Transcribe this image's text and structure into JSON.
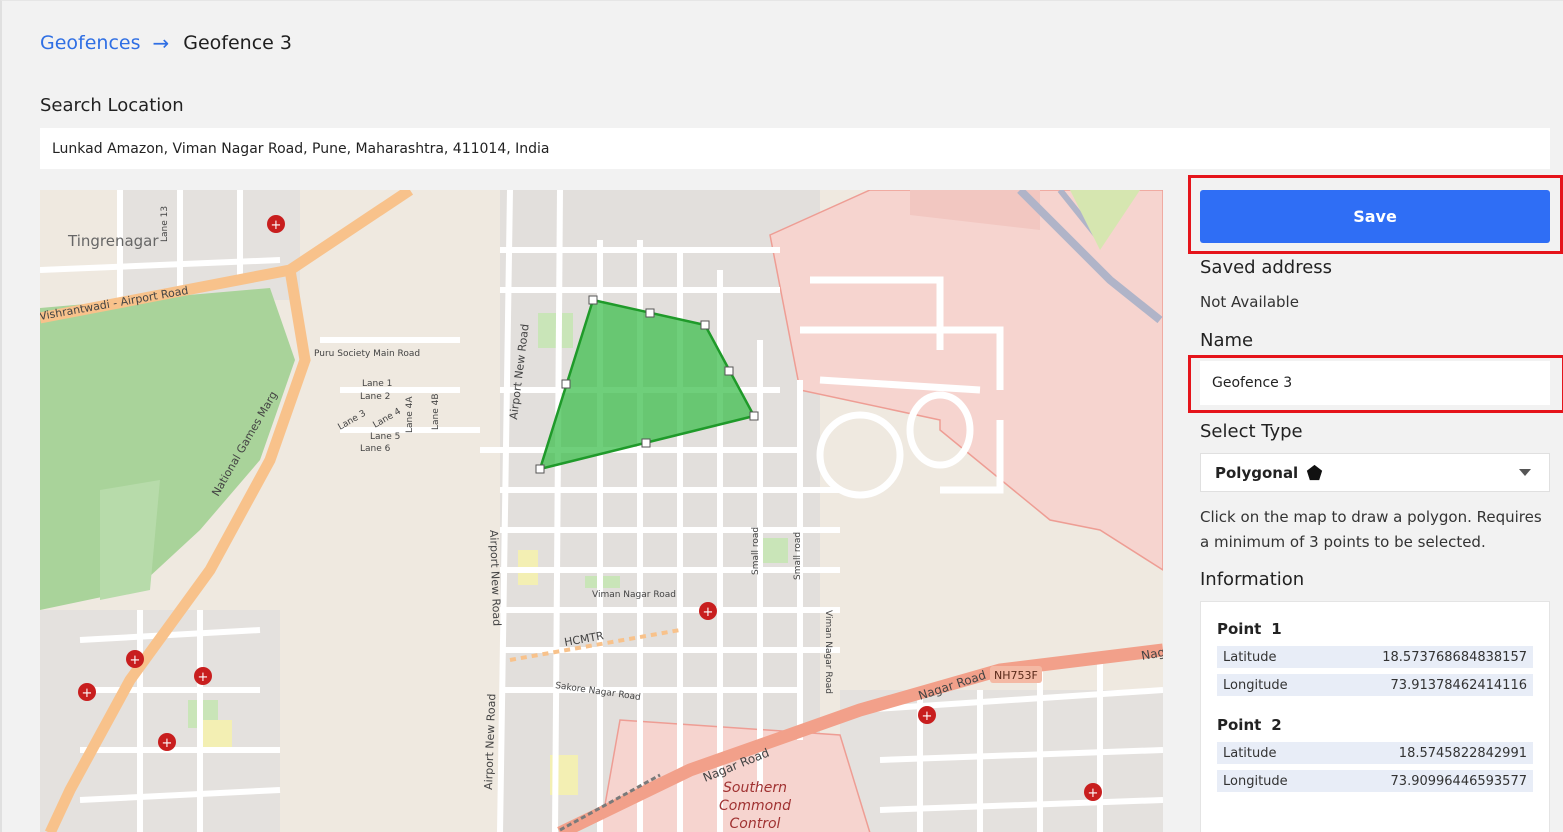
{
  "breadcrumb": {
    "parent": "Geofences",
    "arrow": "→",
    "current": "Geofence 3"
  },
  "search": {
    "label": "Search Location",
    "value": "Lunkad Amazon, Viman Nagar Road, Pune, Maharashtra, 411014, India"
  },
  "map": {
    "labels": {
      "tingrenagar": "Tingrenagar",
      "vishrantwadi": "Vishrantwadi - Airport Road",
      "national_games": "National Games Marg",
      "puru_society": "Puru Society Main Road",
      "lane1": "Lane 1",
      "lane2": "Lane 2",
      "lane3": "Lane 3",
      "lane4": "Lane 4",
      "lane4a": "Lane 4A",
      "lane4b": "Lane 4B",
      "lane5": "Lane 5",
      "lane6": "Lane 6",
      "lane13": "Lane 13",
      "airport_new_road_1": "Airport New Road",
      "airport_new_road_2": "Airport New Road",
      "airport_new_road_3": "Airport New Road",
      "viman_nagar_road_1": "Viman Nagar Road",
      "viman_nagar_road_2": "Viman Nagar Road",
      "hcmtr": "HCMTR",
      "sakore_nagar": "Sakore Nagar Road",
      "small_road_1": "Small road",
      "small_road_2": "Small road",
      "nagar_road_1": "Nagar Road",
      "nagar_road_2": "Nagar Road",
      "nagar_road_3": "Nag",
      "nh753f": "NH753F",
      "southern_1": "Southern",
      "southern_2": "Commond",
      "southern_3": "Control"
    },
    "colors": {
      "polygon_fill": "#3fbf4f",
      "polygon_stroke": "#1f9a2a",
      "park": "#a9d39a",
      "military": "#f6cfc9",
      "major_road": "#f8c28b",
      "trunk_road": "#f2a08a"
    }
  },
  "sidebar": {
    "save_label": "Save",
    "saved_address_label": "Saved address",
    "saved_address_value": "Not Available",
    "name_label": "Name",
    "name_value": "Geofence 3",
    "select_type_label": "Select Type",
    "select_type_value": "Polygonal",
    "select_type_icon": "pentagon-icon",
    "hint": "Click on the map to draw a polygon. Requires a minimum of 3 points to be selected.",
    "information_label": "Information",
    "points": [
      {
        "title": "Point",
        "index": "1",
        "lat_label": "Latitude",
        "lat": "18.573768684838157",
        "lng_label": "Longitude",
        "lng": "73.91378462414116"
      },
      {
        "title": "Point",
        "index": "2",
        "lat_label": "Latitude",
        "lat": "18.5745822842991",
        "lng_label": "Longitude",
        "lng": "73.90996446593577"
      }
    ]
  },
  "colors": {
    "accent": "#2f6ef5",
    "link": "#2f6fe4",
    "highlight_outline": "#e5141b"
  }
}
